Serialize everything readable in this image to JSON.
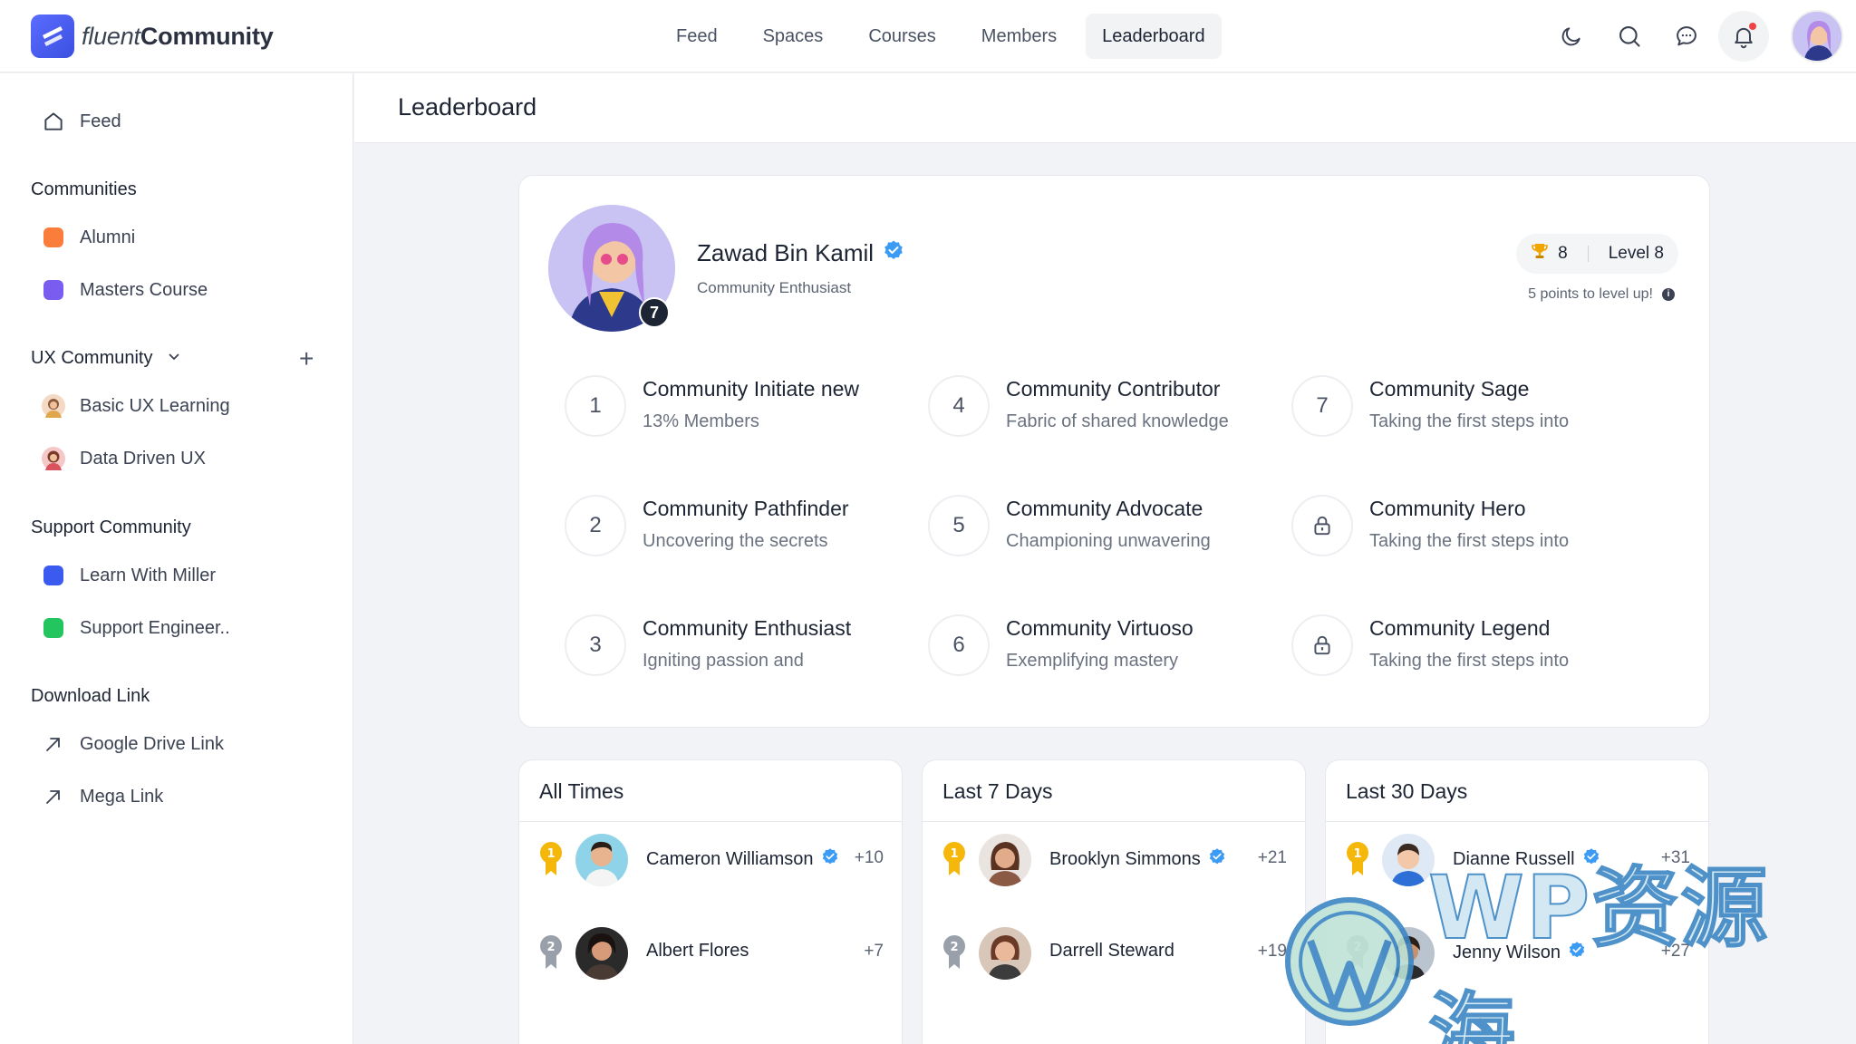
{
  "app": {
    "logo_light": "fluent",
    "logo_bold": "Community"
  },
  "nav": {
    "items": [
      "Feed",
      "Spaces",
      "Courses",
      "Members",
      "Leaderboard"
    ],
    "active": "Leaderboard"
  },
  "sidebar": {
    "feed": "Feed",
    "sections": [
      {
        "title": "Communities",
        "items": [
          {
            "label": "Alumni",
            "color": "#fb7d3c"
          },
          {
            "label": "Masters Course",
            "color": "#7b5cf0"
          }
        ]
      },
      {
        "title": "UX Community",
        "items": [
          {
            "label": "Basic UX Learning"
          },
          {
            "label": "Data Driven UX"
          }
        ]
      },
      {
        "title": "Support Community",
        "items": [
          {
            "label": "Learn With Miller",
            "color": "#3b5bf0"
          },
          {
            "label": "Support Engineer..",
            "color": "#22c55e"
          }
        ]
      },
      {
        "title": "Download Link",
        "items": [
          {
            "label": "Google Drive Link"
          },
          {
            "label": "Mega Link"
          }
        ]
      }
    ]
  },
  "page": {
    "title": "Leaderboard"
  },
  "profile": {
    "name": "Zawad Bin Kamil",
    "subtitle": "Community Enthusiast",
    "badge": "7",
    "trophies": "8",
    "level": "Level 8",
    "points_note": "5 points to level up!"
  },
  "levels": [
    {
      "num": "1",
      "title": "Community Initiate new",
      "desc": "13% Members"
    },
    {
      "num": "4",
      "title": "Community Contributor",
      "desc": "Fabric of shared knowledge"
    },
    {
      "num": "7",
      "title": "Community Sage",
      "desc": "Taking the first steps into"
    },
    {
      "num": "2",
      "title": "Community Pathfinder",
      "desc": "Uncovering the secrets"
    },
    {
      "num": "5",
      "title": "Community Advocate",
      "desc": "Championing unwavering"
    },
    {
      "num": "",
      "title": "Community Hero",
      "desc": "Taking the first steps into",
      "locked": true
    },
    {
      "num": "3",
      "title": "Community Enthusiast",
      "desc": "Igniting passion and"
    },
    {
      "num": "6",
      "title": "Community Virtuoso",
      "desc": "Exemplifying mastery"
    },
    {
      "num": "",
      "title": "Community Legend",
      "desc": "Taking the first steps into",
      "locked": true
    }
  ],
  "leaderboards": [
    {
      "title": "All Times",
      "rows": [
        {
          "rank": "1",
          "name": "Cameron Williamson",
          "verified": true,
          "points": "+10"
        },
        {
          "rank": "2",
          "name": "Albert Flores",
          "verified": false,
          "points": "+7"
        }
      ]
    },
    {
      "title": "Last 7 Days",
      "rows": [
        {
          "rank": "1",
          "name": "Brooklyn Simmons",
          "verified": true,
          "points": "+21"
        },
        {
          "rank": "2",
          "name": "Darrell Steward",
          "verified": false,
          "points": "+19"
        }
      ]
    },
    {
      "title": "Last 30 Days",
      "rows": [
        {
          "rank": "1",
          "name": "Dianne Russell",
          "verified": true,
          "points": "+31"
        },
        {
          "rank": "2",
          "name": "Jenny Wilson",
          "verified": true,
          "points": "+27"
        }
      ]
    }
  ],
  "watermark": "WP资源海",
  "colors": {
    "accent": "#3b5bf0",
    "verified": "#3b9bf5",
    "gold": "#f5b70a",
    "silver": "#9aa0aa"
  }
}
